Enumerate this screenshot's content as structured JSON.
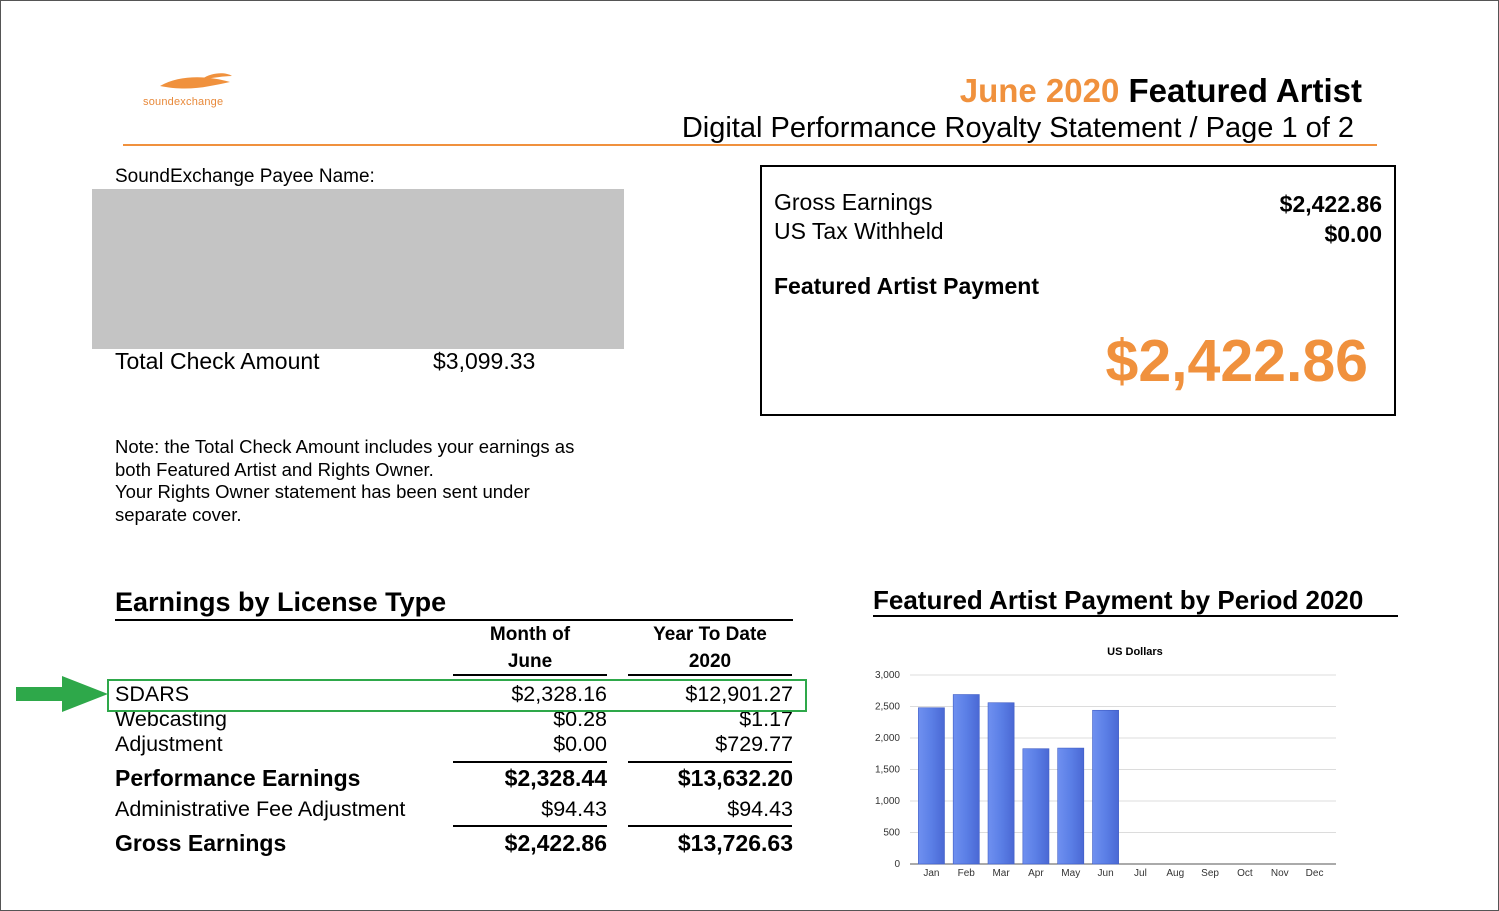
{
  "header": {
    "logo_text": "soundexchange",
    "title_accent": "June 2020",
    "title_main": "Featured Artist",
    "subtitle": "Digital Performance Royalty Statement / Page 1 of 2"
  },
  "payee": {
    "label": "SoundExchange Payee Name:",
    "total_check_label": "Total Check Amount",
    "total_check_value": "$3,099.33",
    "note_lines": [
      "Note: the Total Check Amount includes your earnings as",
      "both Featured Artist and Rights Owner.",
      "Your Rights Owner statement has been sent under",
      "separate cover."
    ]
  },
  "summary": {
    "gross_label": "Gross Earnings",
    "gross_value": "$2,422.86",
    "tax_label": "US Tax Withheld",
    "tax_value": "$0.00",
    "payment_label": "Featured Artist Payment",
    "payment_value": "$2,422.86"
  },
  "earnings": {
    "title": "Earnings by License Type",
    "col1": [
      "Month of",
      "June"
    ],
    "col2": [
      "Year To Date",
      "2020"
    ],
    "rows": [
      {
        "label": "SDARS",
        "month": "$2,328.16",
        "ytd": "$12,901.27"
      },
      {
        "label": "Webcasting",
        "month": "$0.28",
        "ytd": "$1.17"
      },
      {
        "label": "Adjustment",
        "month": "$0.00",
        "ytd": "$729.77"
      },
      {
        "label": "Performance Earnings",
        "month": "$2,328.44",
        "ytd": "$13,632.20"
      },
      {
        "label": "Administrative Fee Adjustment",
        "month": "$94.43",
        "ytd": "$94.43"
      },
      {
        "label": "Gross Earnings",
        "month": "$2,422.86",
        "ytd": "$13,726.63"
      }
    ]
  },
  "colors": {
    "accent": "#f0913d",
    "highlight": "#2ea84a",
    "bar": "#5b7fe6"
  },
  "chart_data": {
    "type": "bar",
    "title": "Featured Artist Payment by Period 2020",
    "subtitle": "US Dollars",
    "categories": [
      "Jan",
      "Feb",
      "Mar",
      "Apr",
      "May",
      "Jun",
      "Jul",
      "Aug",
      "Sep",
      "Oct",
      "Nov",
      "Dec"
    ],
    "values": [
      2480,
      2690,
      2560,
      1830,
      1840,
      2440,
      null,
      null,
      null,
      null,
      null,
      null
    ],
    "ylim": [
      0,
      3000
    ],
    "yticks": [
      0,
      500,
      1000,
      1500,
      2000,
      2500,
      3000
    ],
    "ytick_labels": [
      "0",
      "500",
      "1,000",
      "1,500",
      "2,000",
      "2,500",
      "3,000"
    ],
    "grid": true
  }
}
